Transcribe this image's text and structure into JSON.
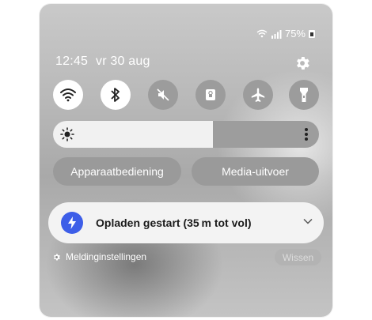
{
  "status_bar": {
    "battery": "75%",
    "icons": [
      "wifi-calling-icon",
      "signal-icon",
      "battery-icon"
    ]
  },
  "header": {
    "time": "12:45",
    "date": "vr 30 aug",
    "settings_icon": "gear-icon"
  },
  "quick_tiles": [
    {
      "name": "wifi",
      "icon": "wifi-icon",
      "state": "on"
    },
    {
      "name": "bluetooth",
      "icon": "bluetooth-icon",
      "state": "on"
    },
    {
      "name": "sound",
      "icon": "mute-icon",
      "state": "off"
    },
    {
      "name": "rotation-lock",
      "icon": "lock-icon",
      "state": "off"
    },
    {
      "name": "airplane",
      "icon": "airplane-icon",
      "state": "off"
    },
    {
      "name": "flashlight",
      "icon": "flashlight-icon",
      "state": "off"
    }
  ],
  "brightness": {
    "level": 0.6
  },
  "buttons": {
    "device_control": "Apparaatbediening",
    "media_output": "Media-uitvoer"
  },
  "notification": {
    "text": "Opladen gestart (35 m tot vol)",
    "icon": "lightning-icon"
  },
  "footer": {
    "settings_label": "Meldinginstellingen",
    "clear_label": "Wissen"
  },
  "colors": {
    "accent": "#3d5ee8",
    "tile_on": "#ffffff",
    "tile_off": "#9c9c9c"
  }
}
